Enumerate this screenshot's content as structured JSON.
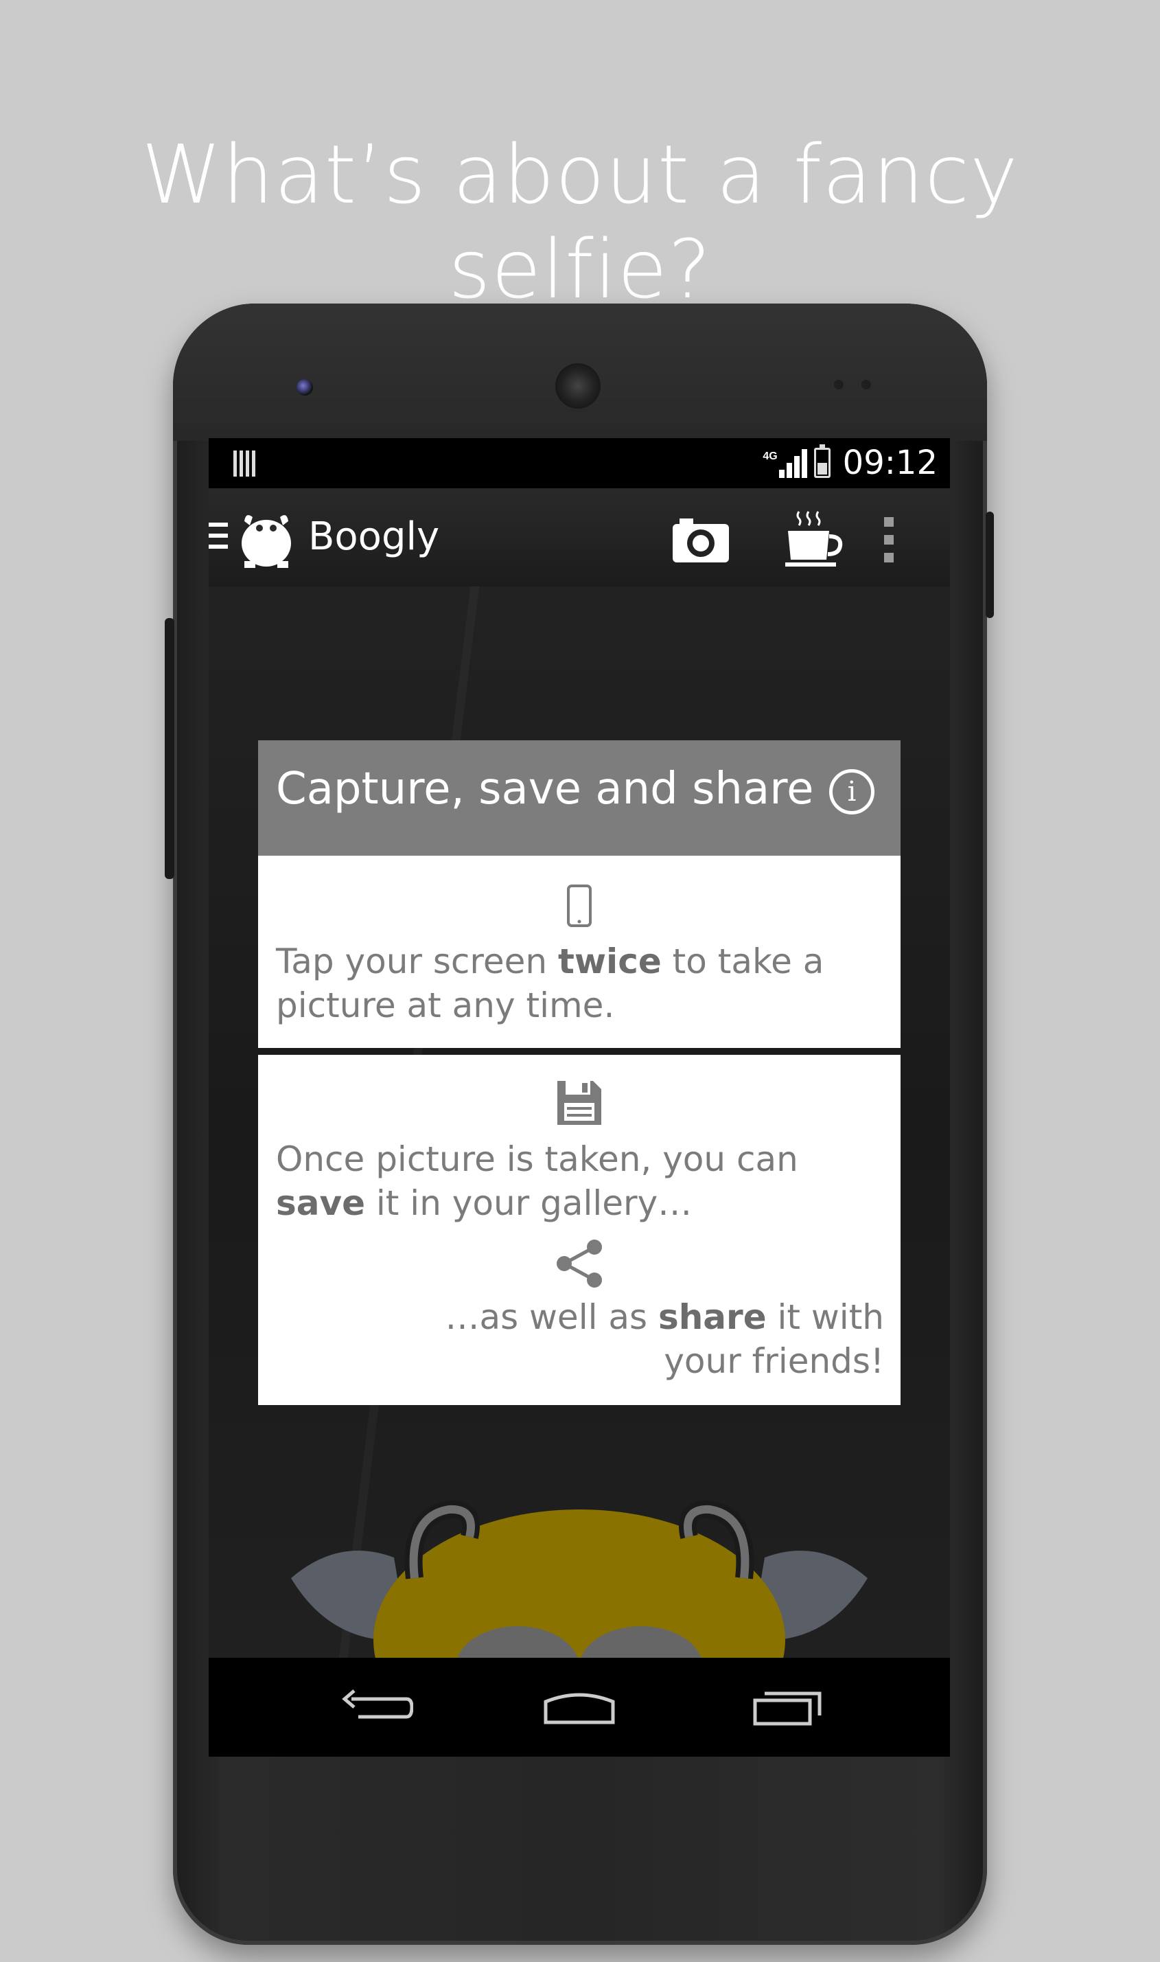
{
  "headline": "What’s about a fancy selfie?",
  "status_bar": {
    "network": "4G",
    "time": "09:12"
  },
  "action_bar": {
    "app_title": "Boogly",
    "icons": [
      "menu-icon",
      "app-logo-icon",
      "camera-icon",
      "coffee-cup-icon",
      "overflow-menu-icon"
    ]
  },
  "dialog": {
    "title": "Capture, save and share",
    "info_icon": "info-icon",
    "tip1": {
      "pre": "Tap your screen ",
      "bold": "twice",
      "post": " to take a picture at any time."
    },
    "tip2": {
      "pre": "Once picture is taken, you can ",
      "bold": "save",
      "post": " it in your gallery…"
    },
    "tip3": {
      "pre": "…as well as ",
      "bold": "share",
      "post": " it with your friends!"
    }
  },
  "nav_bar": {
    "icons": [
      "back-icon",
      "home-icon",
      "recent-apps-icon"
    ]
  },
  "colors": {
    "background": "#cbcbcb",
    "dialog_header": "#7d7d7d",
    "dialog_text": "#7b7b7b",
    "mascot_yellow": "#c9a200"
  }
}
